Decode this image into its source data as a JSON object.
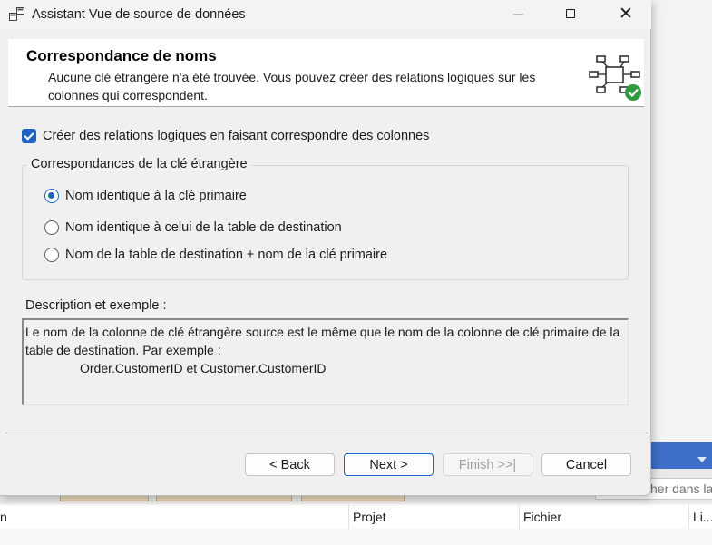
{
  "window": {
    "title": "Assistant Vue de source de données"
  },
  "header": {
    "title": "Correspondance de noms",
    "description": "Aucune clé étrangère n'a été trouvée. Vous pouvez créer des relations logiques sur les colonnes qui correspondent."
  },
  "options": {
    "create_relations_label": "Créer des relations logiques en faisant correspondre des colonnes",
    "create_relations_checked": true
  },
  "foreign_key_group": {
    "legend": "Correspondances de la clé étrangère",
    "choices": [
      {
        "label": "Nom identique à la clé primaire",
        "selected": true
      },
      {
        "label": "Nom identique à celui de la table de destination",
        "selected": false
      },
      {
        "label": "Nom de la table de destination + nom de la clé primaire",
        "selected": false
      }
    ]
  },
  "description": {
    "label": "Description et exemple :",
    "text": "Le nom de la colonne de clé étrangère source est le même que le nom de la colonne de clé primaire de la table de destination. Par exemple :",
    "example": "Order.CustomerID et Customer.CustomerID"
  },
  "buttons": {
    "back": "< Back",
    "next": "Next >",
    "finish": "Finish >>|",
    "cancel": "Cancel"
  },
  "background": {
    "search_text": "her dans la",
    "columns": [
      "n",
      "Projet",
      "Fichier",
      "Li..."
    ]
  },
  "colors": {
    "accent": "#1e63c4",
    "background_strip": "#3f6ec8"
  }
}
